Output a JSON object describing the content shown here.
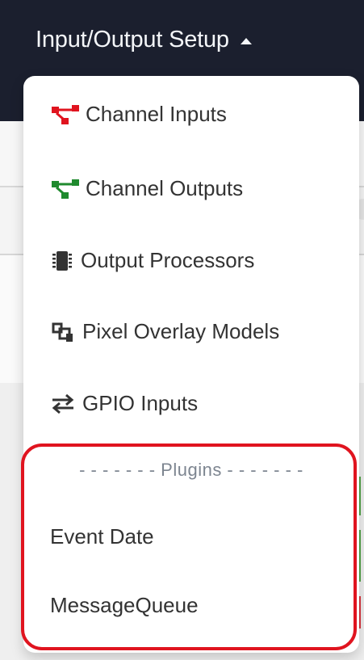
{
  "navbar": {
    "title": "Input/Output Setup",
    "caret_icon": "caret-up-icon",
    "background": "#1b1f2e"
  },
  "dropdown": {
    "items": [
      {
        "label": "Channel Inputs",
        "icon": "channel-inputs-icon",
        "icon_color": "#e0141f"
      },
      {
        "label": "Channel Outputs",
        "icon": "channel-outputs-icon",
        "icon_color": "#1f8a2e"
      },
      {
        "label": "Output Processors",
        "icon": "microchip-icon",
        "icon_color": "#333333"
      },
      {
        "label": "Pixel Overlay Models",
        "icon": "object-group-icon",
        "icon_color": "#333333"
      },
      {
        "label": "GPIO Inputs",
        "icon": "exchange-arrows-icon",
        "icon_color": "#333333"
      }
    ],
    "plugins_header": "- - - - - - - Plugins - - - - - - -",
    "plugins": [
      {
        "label": "Event Date"
      },
      {
        "label": "MessageQueue"
      }
    ]
  },
  "annotation": {
    "color": "#e0141f"
  }
}
